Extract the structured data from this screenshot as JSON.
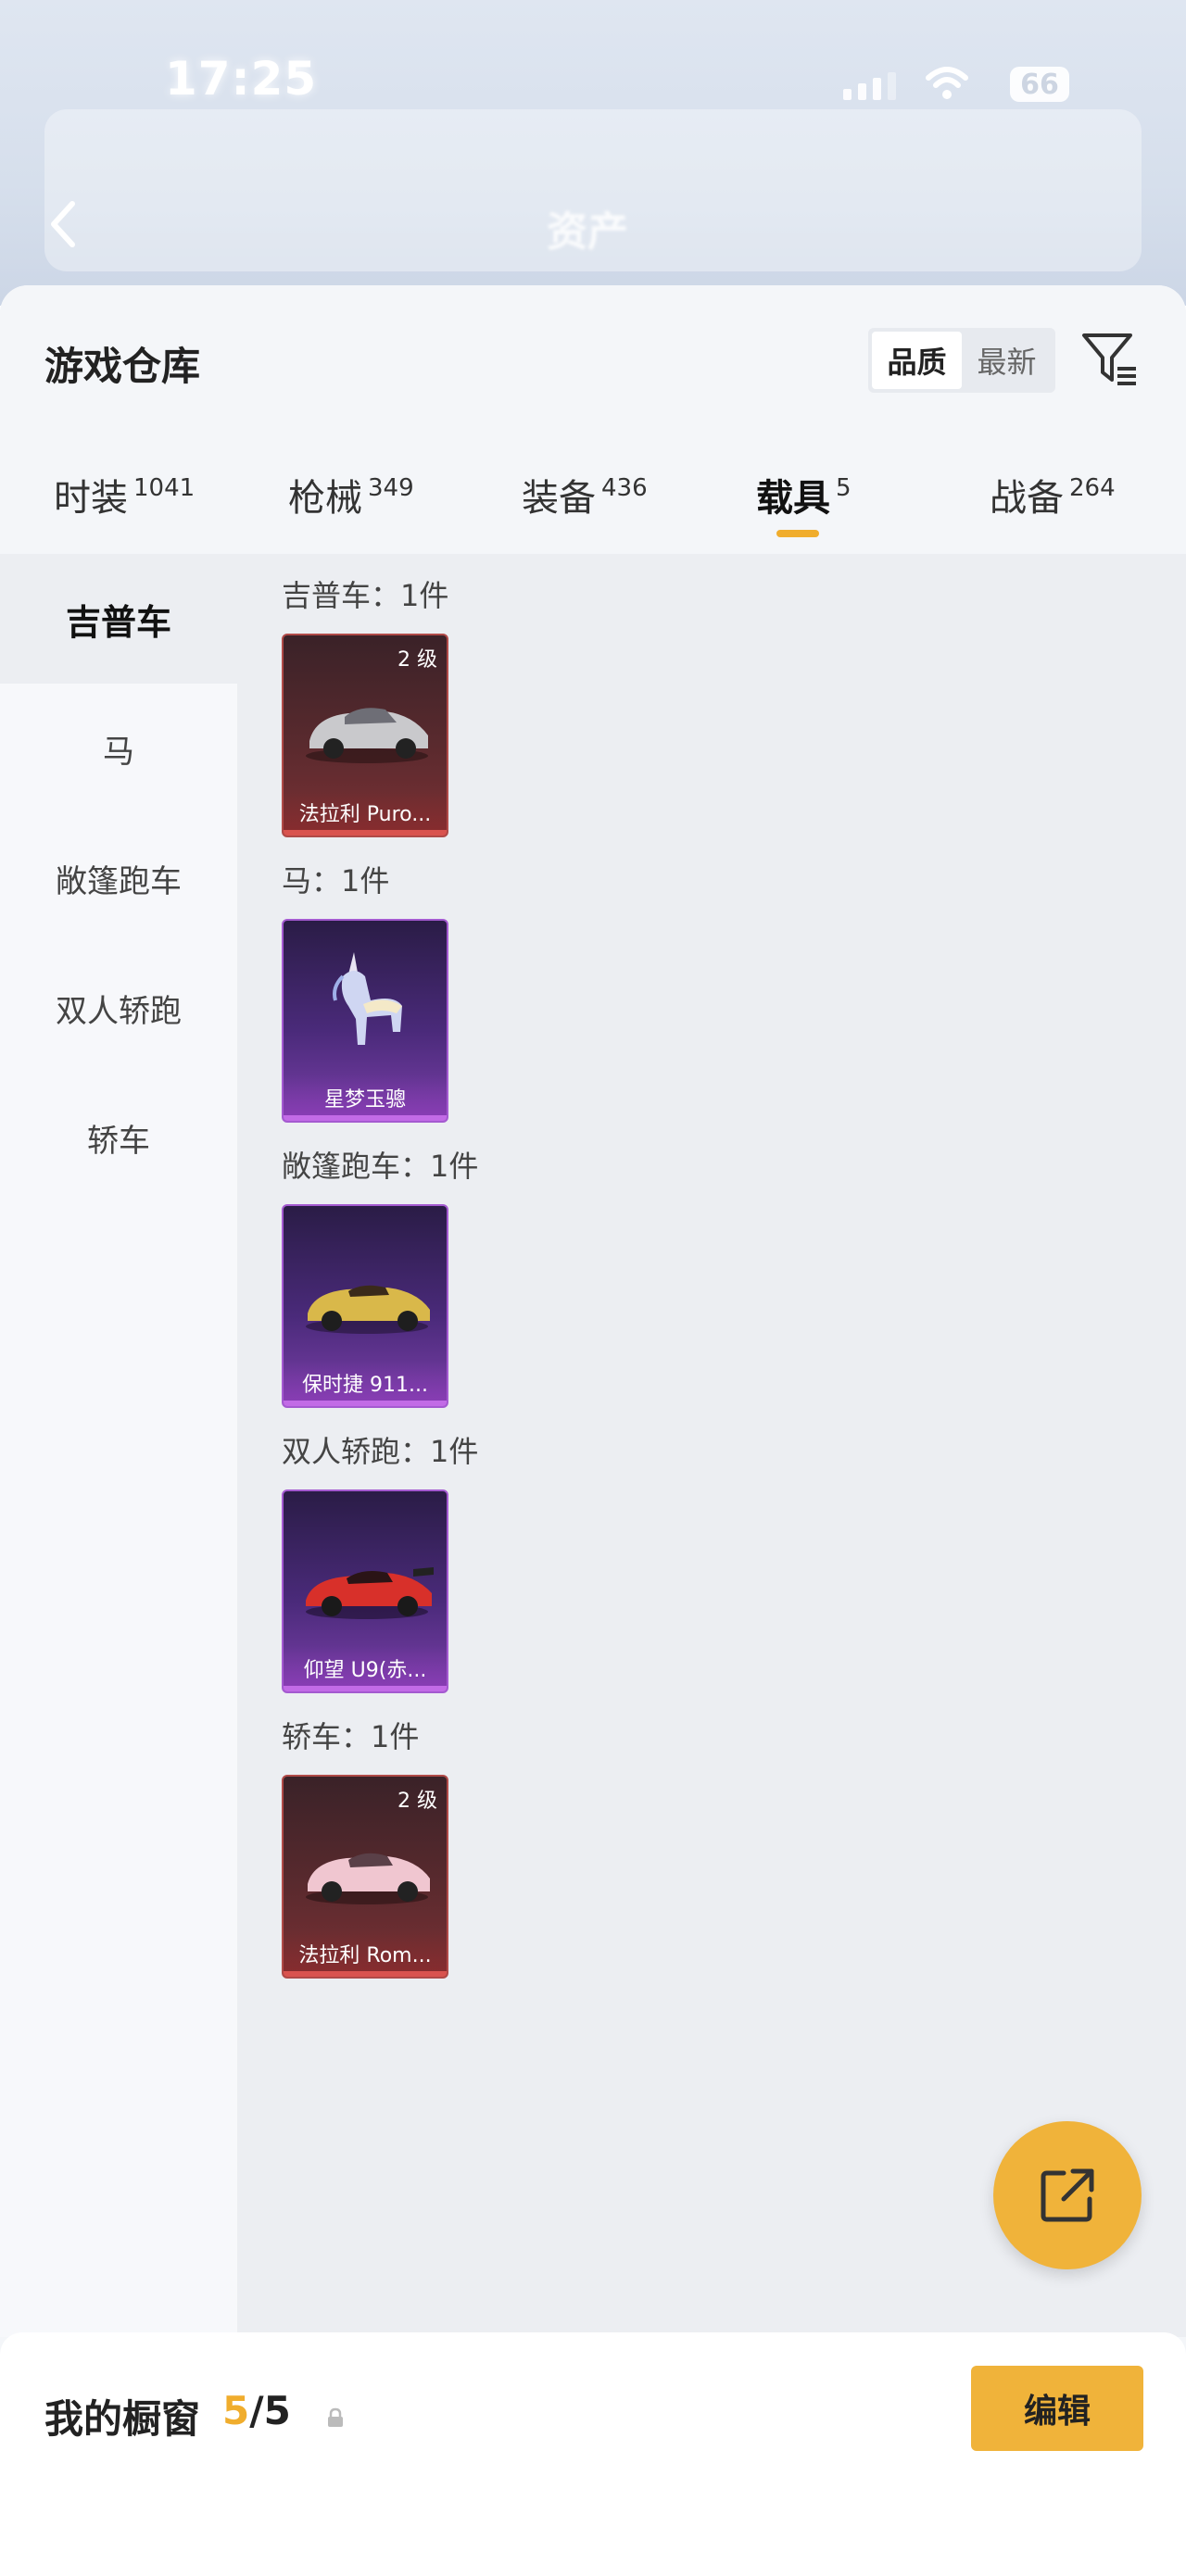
{
  "status": {
    "time": "17:25",
    "battery": "66"
  },
  "background": {
    "title": "资产"
  },
  "warehouse": {
    "title": "游戏仓库",
    "sort_options": [
      "品质",
      "最新"
    ],
    "tabs": [
      {
        "label": "时装",
        "count": "1041"
      },
      {
        "label": "枪械",
        "count": "349"
      },
      {
        "label": "装备",
        "count": "436"
      },
      {
        "label": "载具",
        "count": "5"
      },
      {
        "label": "战备",
        "count": "264"
      }
    ],
    "active_tab": "载具",
    "categories": [
      "吉普车",
      "马",
      "敞篷跑车",
      "双人轿跑",
      "轿车"
    ],
    "groups": [
      {
        "title": "吉普车：1件",
        "item": {
          "name": "法拉利 Puro...",
          "level": "2 级",
          "quality": "red"
        }
      },
      {
        "title": "马：1件",
        "item": {
          "name": "星梦玉骢",
          "level": "",
          "quality": "purple"
        }
      },
      {
        "title": "敞篷跑车：1件",
        "item": {
          "name": "保时捷 911...",
          "level": "",
          "quality": "purple"
        }
      },
      {
        "title": "双人轿跑：1件",
        "item": {
          "name": "仰望 U9(赤...",
          "level": "",
          "quality": "purple"
        }
      },
      {
        "title": "轿车：1件",
        "item": {
          "name": "法拉利 Rom...",
          "level": "2 级",
          "quality": "red"
        }
      }
    ]
  },
  "showcase": {
    "title": "我的橱窗",
    "current": "5",
    "total": "/5",
    "edit_label": "编辑"
  },
  "colors": {
    "accent": "#f0b33a",
    "red_card": "#b04a48",
    "purple_card": "#a45ad0"
  }
}
